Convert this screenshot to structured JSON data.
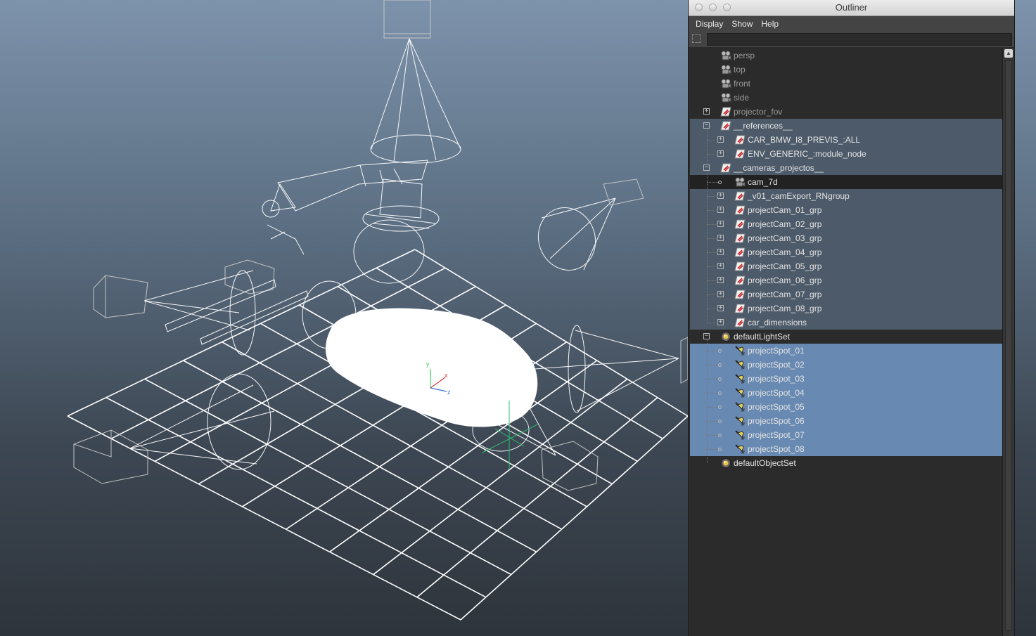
{
  "window": {
    "title": "Outliner"
  },
  "menus": [
    "Display",
    "Show",
    "Help"
  ],
  "filter": {
    "value": "",
    "placeholder": ""
  },
  "tree": [
    {
      "label": "persp",
      "icon": "camera",
      "level": 1,
      "expander": "none",
      "style": "dim"
    },
    {
      "label": "top",
      "icon": "camera",
      "level": 1,
      "expander": "none",
      "style": "dim"
    },
    {
      "label": "front",
      "icon": "camera",
      "level": 1,
      "expander": "none",
      "style": "dim"
    },
    {
      "label": "side",
      "icon": "camera",
      "level": 1,
      "expander": "none",
      "style": "dim"
    },
    {
      "label": "projector_fov",
      "icon": "reference",
      "level": 1,
      "expander": "plus",
      "style": "dim"
    },
    {
      "label": "__references__",
      "icon": "reference",
      "level": 1,
      "expander": "minus",
      "style": "selected"
    },
    {
      "label": "CAR_BMW_I8_PREVIS_:ALL",
      "icon": "reference",
      "level": 2,
      "expander": "plus",
      "style": "selected"
    },
    {
      "label": "ENV_GENERIC_:module_node",
      "icon": "reference",
      "level": 2,
      "expander": "plus",
      "style": "selected"
    },
    {
      "label": "__cameras_projectos__",
      "icon": "reference",
      "level": 1,
      "expander": "minus",
      "style": "selected"
    },
    {
      "label": "cam_7d",
      "icon": "camera",
      "level": 2,
      "expander": "dot",
      "style": "active"
    },
    {
      "label": "_v01_camExport_RNgroup",
      "icon": "reference",
      "level": 2,
      "expander": "plus",
      "style": "selected"
    },
    {
      "label": "projectCam_01_grp",
      "icon": "reference",
      "level": 2,
      "expander": "plus",
      "style": "selected"
    },
    {
      "label": "projectCam_02_grp",
      "icon": "reference",
      "level": 2,
      "expander": "plus",
      "style": "selected"
    },
    {
      "label": "projectCam_03_grp",
      "icon": "reference",
      "level": 2,
      "expander": "plus",
      "style": "selected"
    },
    {
      "label": "projectCam_04_grp",
      "icon": "reference",
      "level": 2,
      "expander": "plus",
      "style": "selected"
    },
    {
      "label": "projectCam_05_grp",
      "icon": "reference",
      "level": 2,
      "expander": "plus",
      "style": "selected"
    },
    {
      "label": "projectCam_06_grp",
      "icon": "reference",
      "level": 2,
      "expander": "plus",
      "style": "selected"
    },
    {
      "label": "projectCam_07_grp",
      "icon": "reference",
      "level": 2,
      "expander": "plus",
      "style": "selected"
    },
    {
      "label": "projectCam_08_grp",
      "icon": "reference",
      "level": 2,
      "expander": "plus",
      "style": "selected"
    },
    {
      "label": "car_dimensions",
      "icon": "reference",
      "level": 2,
      "expander": "plus",
      "style": "selected"
    },
    {
      "label": "defaultLightSet",
      "icon": "set",
      "level": 1,
      "expander": "minus",
      "style": "normal"
    },
    {
      "label": "projectSpot_01",
      "icon": "spotlight",
      "level": 2,
      "expander": "dot",
      "style": "highlight"
    },
    {
      "label": "projectSpot_02",
      "icon": "spotlight",
      "level": 2,
      "expander": "dot",
      "style": "highlight"
    },
    {
      "label": "projectSpot_03",
      "icon": "spotlight",
      "level": 2,
      "expander": "dot",
      "style": "highlight"
    },
    {
      "label": "projectSpot_04",
      "icon": "spotlight",
      "level": 2,
      "expander": "dot",
      "style": "highlight"
    },
    {
      "label": "projectSpot_05",
      "icon": "spotlight",
      "level": 2,
      "expander": "dot",
      "style": "highlight"
    },
    {
      "label": "projectSpot_06",
      "icon": "spotlight",
      "level": 2,
      "expander": "dot",
      "style": "highlight"
    },
    {
      "label": "projectSpot_07",
      "icon": "spotlight",
      "level": 2,
      "expander": "dot",
      "style": "highlight"
    },
    {
      "label": "projectSpot_08",
      "icon": "spotlight",
      "level": 2,
      "expander": "dot",
      "style": "highlight"
    },
    {
      "label": "defaultObjectSet",
      "icon": "set",
      "level": 1,
      "expander": "none",
      "style": "normal"
    }
  ],
  "viewport": {
    "axis_labels": {
      "x": "x",
      "y": "y",
      "z": "z"
    }
  },
  "colors": {
    "selected_row": "#4c5a69",
    "highlight_row": "#6889b1",
    "active_row": "#222222",
    "panel_bg": "#2b2b2b"
  }
}
